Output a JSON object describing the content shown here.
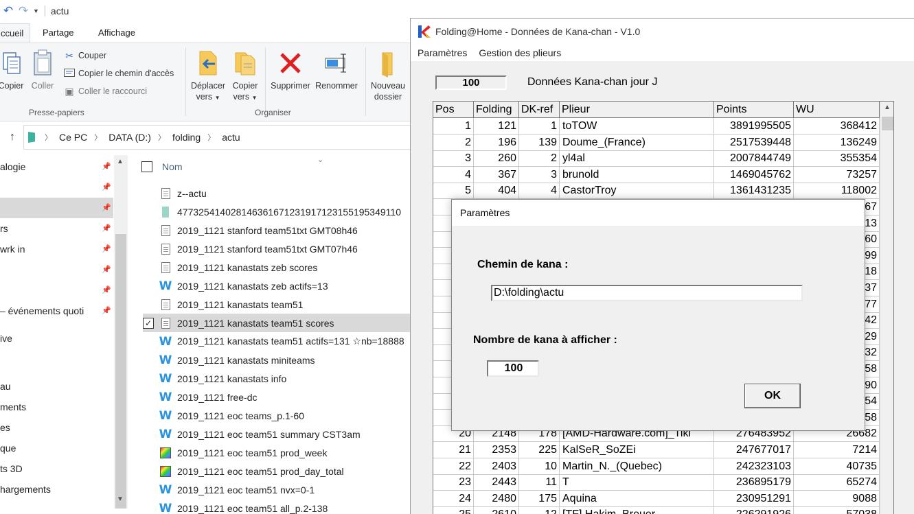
{
  "explorer": {
    "title": "actu",
    "tabs": [
      "ccueil",
      "Partage",
      "Affichage"
    ],
    "ribbon": {
      "copier": "Copier",
      "coller": "Coller",
      "couper": "Couper",
      "copier_chemin": "Copier le chemin d'accès",
      "coller_raccourci": "Coller le raccourci",
      "presse_papiers": "Presse-papiers",
      "deplacer_l1": "Déplacer",
      "deplacer_l2": "vers",
      "copier_vers_l1": "Copier",
      "copier_vers_l2": "vers",
      "supprimer": "Supprimer",
      "renommer": "Renommer",
      "organiser": "Organiser",
      "nouveau_l1": "Nouveau",
      "nouveau_l2": "dossier"
    },
    "breadcrumb": [
      "Ce PC",
      "DATA (D:)",
      "folding",
      "actu"
    ],
    "nav_items": [
      "alogie",
      "",
      "",
      "rs",
      "wrk in",
      "",
      "",
      "– événements quoti",
      "ive",
      "",
      "au",
      "ments",
      "es",
      "que",
      "ts 3D",
      "hargements"
    ],
    "column_name": "Nom",
    "files": [
      {
        "name": "z--actu",
        "icon": "text-file-icon"
      },
      {
        "name": "477325414028146361671231917123155195349110",
        "icon": "folder-icon"
      },
      {
        "name": "2019_1121 stanford team51txt GMT08h46",
        "icon": "text-file-icon"
      },
      {
        "name": "2019_1121 stanford team51txt GMT07h46",
        "icon": "text-file-icon"
      },
      {
        "name": "2019_1121 kanastats zeb scores",
        "icon": "text-file-icon"
      },
      {
        "name": "2019_1121 kanastats zeb actifs=13",
        "icon": "w-app-icon"
      },
      {
        "name": "2019_1121 kanastats team51",
        "icon": "text-file-icon"
      },
      {
        "name": "2019_1121 kanastats team51 scores",
        "icon": "text-file-icon"
      },
      {
        "name": "2019_1121 kanastats team51 actifs=131 ☆nb=18888",
        "icon": "w-app-icon"
      },
      {
        "name": "2019_1121 kanastats miniteams",
        "icon": "w-app-icon"
      },
      {
        "name": "2019_1121 kanastats info",
        "icon": "w-app-icon"
      },
      {
        "name": "2019_1121 free-dc",
        "icon": "w-app-icon"
      },
      {
        "name": "2019_1121 eoc teams_p.1-60",
        "icon": "w-app-icon"
      },
      {
        "name": "2019_1121 eoc team51 summary CST3am",
        "icon": "w-app-icon"
      },
      {
        "name": "2019_1121 eoc team51 prod_week",
        "icon": "image-file-icon"
      },
      {
        "name": "2019_1121 eoc team51 prod_day_total",
        "icon": "image-file-icon"
      },
      {
        "name": "2019_1121 eoc team51 nvx=0-1",
        "icon": "w-app-icon"
      },
      {
        "name": "2019_1121 eoc team51 all_p.2-138",
        "icon": "w-app-icon"
      }
    ]
  },
  "kana": {
    "window_title": "Folding@Home - Données de Kana-chan - V1.0",
    "menu": [
      "Paramètres",
      "Gestion des plieurs"
    ],
    "count": "100",
    "heading": "Données Kana-chan jour J",
    "columns": [
      "Pos",
      "Folding",
      "DK-ref",
      "Plieur",
      "Points",
      "WU"
    ],
    "rows": [
      [
        "1",
        "121",
        "1",
        "toTOW",
        "3891995505",
        "368412"
      ],
      [
        "2",
        "196",
        "139",
        "Doume_(France)",
        "2517539448",
        "136249"
      ],
      [
        "3",
        "260",
        "2",
        "yl4al",
        "2007844749",
        "355354"
      ],
      [
        "4",
        "367",
        "3",
        "brunold",
        "1469045762",
        "73257"
      ],
      [
        "5",
        "404",
        "4",
        "CastorTroy",
        "1361431235",
        "118002"
      ],
      [
        "",
        "",
        "",
        "",
        "",
        "67"
      ],
      [
        "",
        "",
        "",
        "",
        "",
        "13"
      ],
      [
        "",
        "",
        "",
        "",
        "",
        "60"
      ],
      [
        "",
        "",
        "",
        "",
        "",
        "99"
      ],
      [
        "",
        "",
        "",
        "",
        "",
        "18"
      ],
      [
        "",
        "",
        "",
        "",
        "",
        "37"
      ],
      [
        "",
        "",
        "",
        "",
        "",
        "77"
      ],
      [
        "",
        "",
        "",
        "",
        "",
        "42"
      ],
      [
        "",
        "",
        "",
        "",
        "",
        "29"
      ],
      [
        "",
        "",
        "",
        "",
        "",
        "32"
      ],
      [
        "",
        "",
        "",
        "",
        "",
        "58"
      ],
      [
        "",
        "",
        "",
        "",
        "",
        "90"
      ],
      [
        "",
        "",
        "",
        "",
        "",
        "54"
      ],
      [
        "",
        "",
        "",
        "",
        "",
        "58"
      ],
      [
        "20",
        "2148",
        "178",
        "[AMD-Hardware.com]_Tiki",
        "276483952",
        "26682"
      ],
      [
        "21",
        "2353",
        "225",
        "KalSeR_SoZEi",
        "247677017",
        "7214"
      ],
      [
        "22",
        "2403",
        "10",
        "Martin_N._(Quebec)",
        "242323103",
        "40735"
      ],
      [
        "23",
        "2443",
        "11",
        "T",
        "236895179",
        "65274"
      ],
      [
        "24",
        "2480",
        "175",
        "Aquina",
        "230951291",
        "9088"
      ],
      [
        "25",
        "2610",
        "12",
        "[TF] Hakim_Breuer",
        "226291926",
        "57038"
      ]
    ]
  },
  "dialog": {
    "title": "Paramètres",
    "chemin_label": "Chemin de kana :",
    "chemin_value": "D:\\folding\\actu",
    "nombre_label": "Nombre de kana à afficher :",
    "nombre_value": "100",
    "ok_label": "OK"
  },
  "colors": {
    "selection": "#d9d9d9",
    "w_icon": "#2a93e0",
    "delete_red": "#e02020",
    "folder_yellow": "#f6c95b"
  }
}
